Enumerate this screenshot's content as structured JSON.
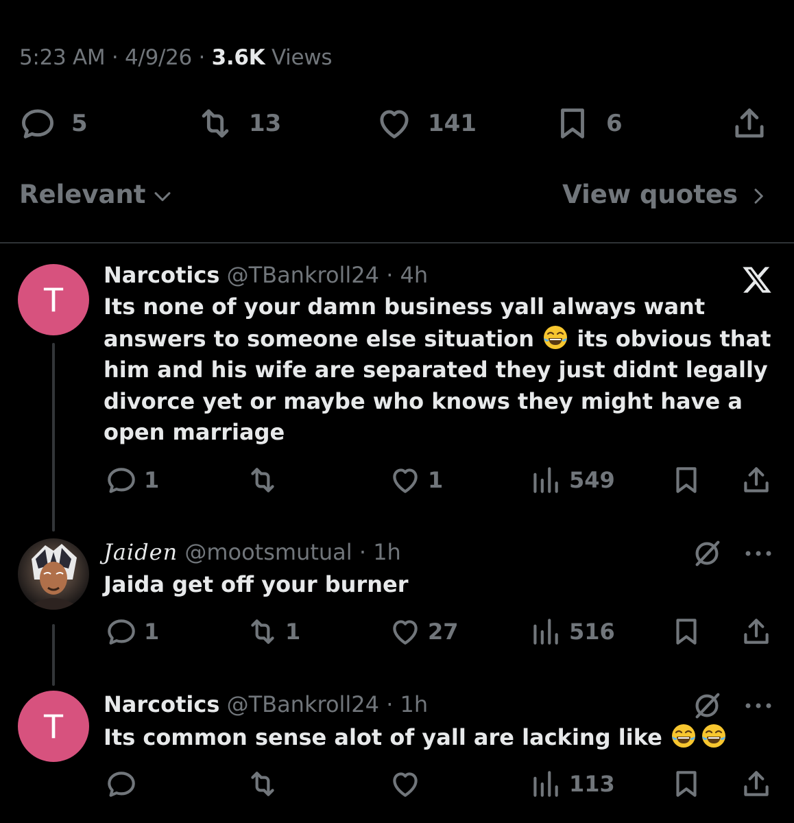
{
  "post_meta": {
    "time": "5:23 AM",
    "sep1": " · ",
    "date": "4/9/26",
    "sep2": " · ",
    "views_count": "3.6K",
    "views_label": " Views"
  },
  "post_actions": {
    "replies": "5",
    "reposts": "13",
    "likes": "141",
    "bookmarks": "6"
  },
  "sort": {
    "label": "Relevant",
    "view_quotes": "View quotes"
  },
  "replies": [
    {
      "avatar_letter": "T",
      "name": "Narcotics",
      "handle": "@TBankroll24",
      "sep": " · ",
      "time": "4h",
      "text_part1": "Its none of your damn business yall always want answers to someone else situation ",
      "emoji": "joy",
      "text_part2": " its obvious that him and his wife are separated they just didnt legally divorce yet or maybe who knows they might have a open marriage",
      "actions": {
        "replies": "1",
        "reposts": "",
        "likes": "1",
        "views": "549"
      }
    },
    {
      "avatar_letter": "",
      "name": "Jaiden",
      "handle": "@mootsmutual",
      "sep": " · ",
      "time": "1h",
      "text": "Jaida get off your burner",
      "actions": {
        "replies": "1",
        "reposts": "1",
        "likes": "27",
        "views": "516"
      }
    },
    {
      "avatar_letter": "T",
      "name": "Narcotics",
      "handle": "@TBankroll24",
      "sep": " · ",
      "time": "1h",
      "text": "Its common sense alot of yall are lacking like ",
      "emoji": "joy",
      "actions": {
        "replies": "",
        "reposts": "",
        "likes": "",
        "views": "113"
      }
    }
  ],
  "colors": {
    "background": "#000000",
    "text": "#e7e9ea",
    "muted": "#71767b",
    "avatar_pink": "#d7527e",
    "divider": "#2f3336"
  },
  "icons": [
    "reply-icon",
    "repost-icon",
    "like-icon",
    "bookmark-icon",
    "share-icon",
    "views-icon",
    "chevron-down-icon",
    "chevron-right-icon",
    "x-logo-icon",
    "grok-icon",
    "more-icon",
    "joy-emoji-icon"
  ]
}
